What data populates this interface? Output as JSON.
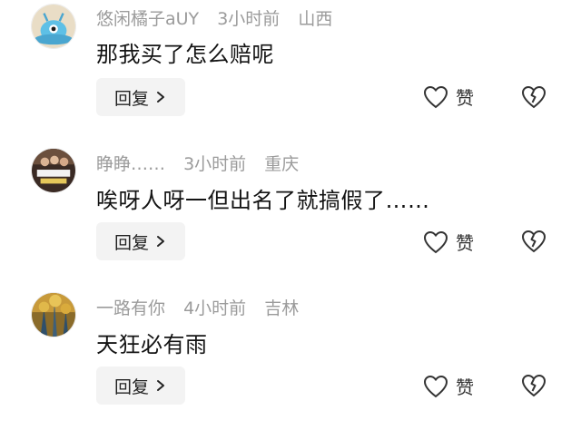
{
  "comments": [
    {
      "username": "悠闲橘子aUY",
      "time": "3小时前",
      "location": "山西",
      "text": "那我买了怎么赔呢",
      "reply_label": "回复",
      "like_label": "赞"
    },
    {
      "username": "睁睁……",
      "time": "3小时前",
      "location": "重庆",
      "text": "唉呀人呀一但出名了就搞假了……",
      "reply_label": "回复",
      "like_label": "赞"
    },
    {
      "username": "一路有你",
      "time": "4小时前",
      "location": "吉林",
      "text": "天狂必有雨",
      "reply_label": "回复",
      "like_label": "赞"
    }
  ],
  "icons": {
    "like": "heart-outline-icon",
    "dislike": "broken-heart-icon",
    "reply_arrow": "chevron-right-icon"
  }
}
